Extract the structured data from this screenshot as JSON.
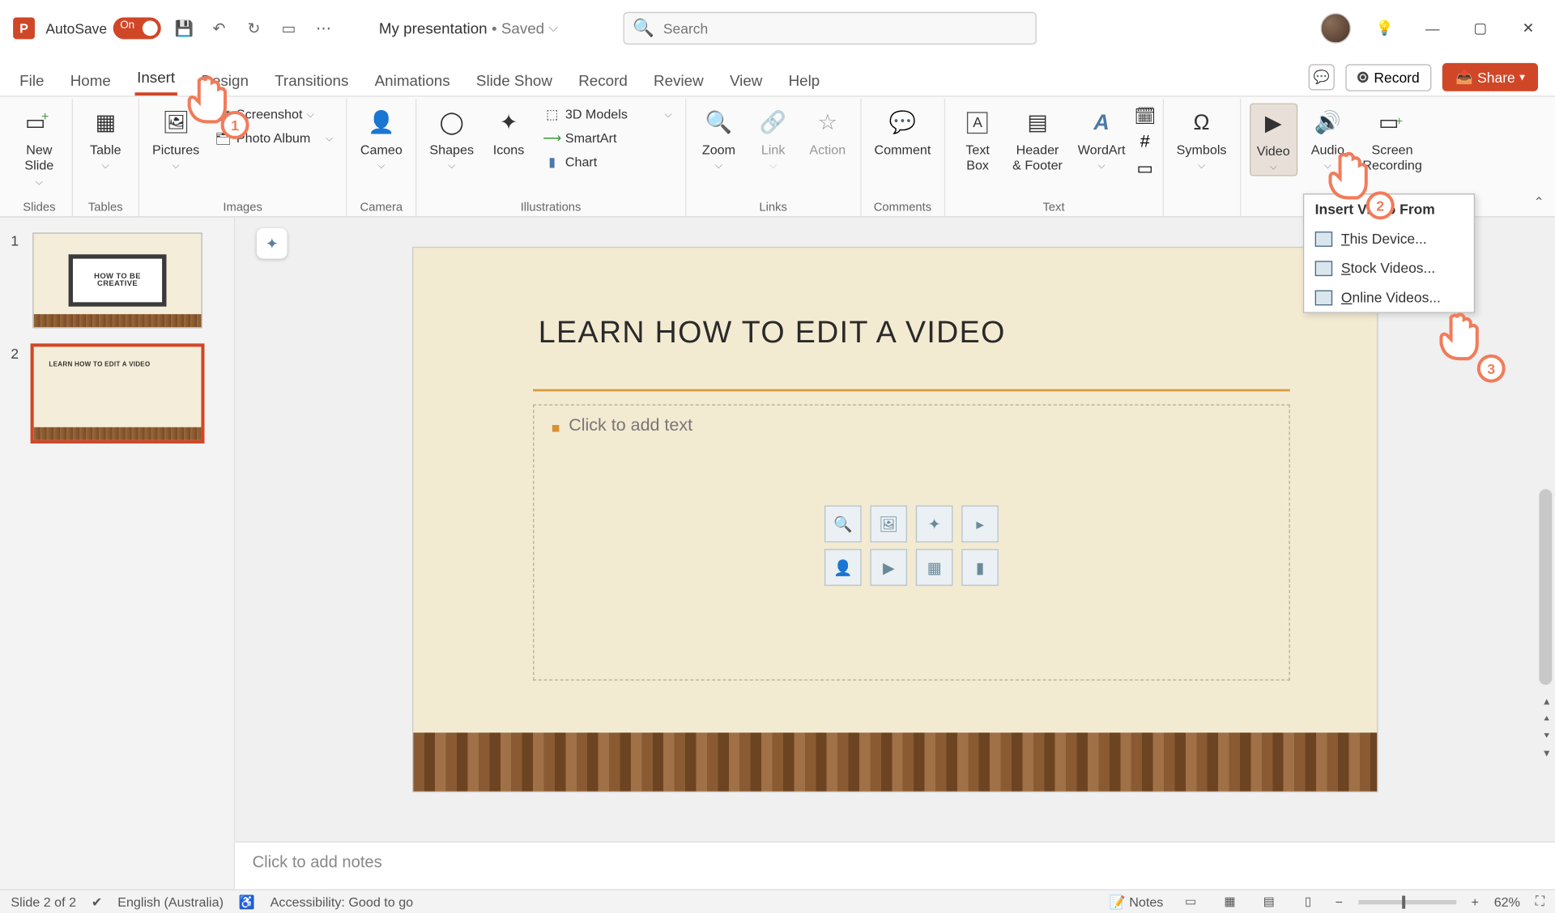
{
  "titlebar": {
    "autosave_label": "AutoSave",
    "autosave_toggle": "On",
    "doc_title": "My presentation",
    "doc_saved": "• Saved",
    "search_placeholder": "Search"
  },
  "tabs": {
    "items": [
      "File",
      "Home",
      "Insert",
      "Design",
      "Transitions",
      "Animations",
      "Slide Show",
      "Record",
      "Review",
      "View",
      "Help"
    ],
    "active_index": 2,
    "record_btn": "Record",
    "share_btn": "Share"
  },
  "ribbon": {
    "groups": {
      "slides": {
        "label": "Slides",
        "new_slide": "New\nSlide"
      },
      "tables": {
        "label": "Tables",
        "table": "Table"
      },
      "images": {
        "label": "Images",
        "pictures": "Pictures",
        "screenshot": "Screenshot",
        "photo_album": "Photo Album"
      },
      "camera": {
        "label": "Camera",
        "cameo": "Cameo"
      },
      "illustrations": {
        "label": "Illustrations",
        "shapes": "Shapes",
        "icons": "Icons",
        "models": "3D Models",
        "smartart": "SmartArt",
        "chart": "Chart"
      },
      "links": {
        "label": "Links",
        "zoom": "Zoom",
        "link": "Link",
        "action": "Action"
      },
      "comments": {
        "label": "Comments",
        "comment": "Comment"
      },
      "text": {
        "label": "Text",
        "textbox": "Text\nBox",
        "header": "Header\n& Footer",
        "wordart": "WordArt"
      },
      "symbols": {
        "label": "",
        "symbols": "Symbols"
      },
      "media": {
        "label": "",
        "video": "Video",
        "audio": "Audio",
        "screenrec": "Screen\nRecording"
      }
    }
  },
  "video_menu": {
    "header": "Insert Video From",
    "this_device": "This Device...",
    "stock_videos": "Stock Videos...",
    "online_videos": "Online Videos..."
  },
  "thumbnails": {
    "items": [
      {
        "num": "1",
        "title_line1": "HOW TO BE",
        "title_line2": "CREATIVE"
      },
      {
        "num": "2",
        "title": "LEARN HOW TO EDIT A VIDEO"
      }
    ]
  },
  "slide": {
    "title": "LEARN HOW TO EDIT A VIDEO",
    "body_placeholder": "Click to add text"
  },
  "notes": {
    "placeholder": "Click to add notes"
  },
  "statusbar": {
    "slide_pos": "Slide 2 of 2",
    "lang": "English (Australia)",
    "accessibility": "Accessibility: Good to go",
    "notes": "Notes",
    "zoom": "62%"
  },
  "annotations": {
    "b1": "1",
    "b2": "2",
    "b3": "3"
  }
}
